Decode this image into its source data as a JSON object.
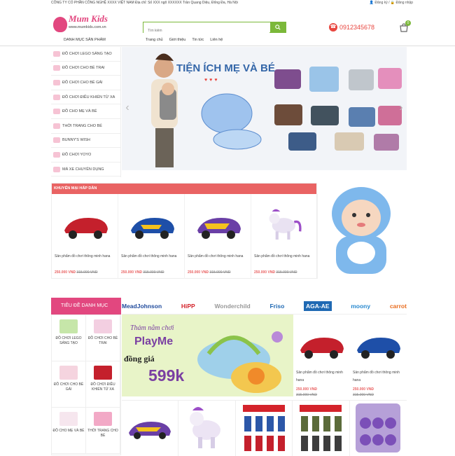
{
  "topbar": {
    "address": "CÔNG TY CỔ PHẦN CÔNG NGHỆ XXXX VIỆT NAM Địa chỉ: Số XXX ngõ XXXXXX Trần Quang Diệu, Đống Đa, Hà Nội",
    "auth": "👤 Đăng ký / 🔒 Đăng nhập"
  },
  "logo": {
    "title": "Mum Kids",
    "url": "www.mumkids.com.vn"
  },
  "search": {
    "placeholder": "Tìm kiếm"
  },
  "phone": "0912345678",
  "cart": {
    "count": "0"
  },
  "nav": {
    "category_label": "DANH MỤC SẢN PHẨM",
    "items": [
      "Trang chủ",
      "Giới thiệu",
      "Tin tức",
      "Liên hệ"
    ]
  },
  "sidebar": {
    "items": [
      "ĐỒ CHƠI LEGO SÁNG TẠO",
      "ĐỒ CHƠI CHO BÉ TRAI",
      "ĐỒ CHƠI CHO BÉ GÁI",
      "ĐỒ CHƠI ĐIỀU KHIỂN TỪ XA",
      "ĐỒ CHO MẸ VÀ BÉ",
      "THỜI TRANG CHO BÉ",
      "BUNNY'S WISH",
      "ĐỒ CHƠI YOYO",
      "MÁ XE CHUYÊN DỤNG"
    ]
  },
  "banner": {
    "title": "TIỆN ÍCH MẸ VÀ BÉ",
    "hearts": "♥♥♥"
  },
  "promo": {
    "header": "KHUYẾN MẠI HẤP DẪN",
    "products": [
      {
        "name": "Sản phẩm đồ chơi thông minh hana",
        "price": "250.000 VNĐ",
        "old": "315.000 VNĐ"
      },
      {
        "name": "Sản phẩm đồ chơi thông minh hana",
        "price": "250.000 VNĐ",
        "old": "315.000 VNĐ"
      },
      {
        "name": "Sản phẩm đồ chơi thông minh hana",
        "price": "250.000 VNĐ",
        "old": "315.000 VNĐ"
      },
      {
        "name": "Sản phẩm đồ chơi thông minh hana",
        "price": "250.000 VNĐ",
        "old": "315.000 VNĐ"
      }
    ]
  },
  "catbox": {
    "header": "TIÊU ĐỀ DANH MỤC",
    "items": [
      "ĐỒ CHƠI LEGO SÁNG TẠO",
      "ĐỒ CHƠI CHO BÉ TRAI",
      "ĐỒ CHƠI CHO BÉ GÁI",
      "ĐỒ CHƠI ĐIỀU KHIỂN TỪ XA",
      "ĐỒ CHO MẸ VÀ BÉ",
      "THỜI TRANG CHO BÉ"
    ]
  },
  "brands": [
    "MeadJohnson",
    "HiPP",
    "Wonderchild",
    "Friso",
    "AGA-AE",
    "moony",
    "carrot"
  ],
  "ad": {
    "line1": "Thảm nằm chơi",
    "line2": "PlayMe",
    "line3": "đồng giá",
    "price": "599k"
  },
  "grid_products": [
    {
      "name": "Sản phẩm đồ chơi thông minh hana",
      "price": "250.000 VNĐ",
      "old": "315.000 VNĐ"
    },
    {
      "name": "Sản phẩm đồ chơi thông minh hana",
      "price": "250.000 VNĐ",
      "old": "315.000 VNĐ"
    }
  ],
  "colors": {
    "pink": "#e2477f",
    "green": "#7bb83a",
    "red": "#e96363",
    "phone": "#e8463f"
  }
}
